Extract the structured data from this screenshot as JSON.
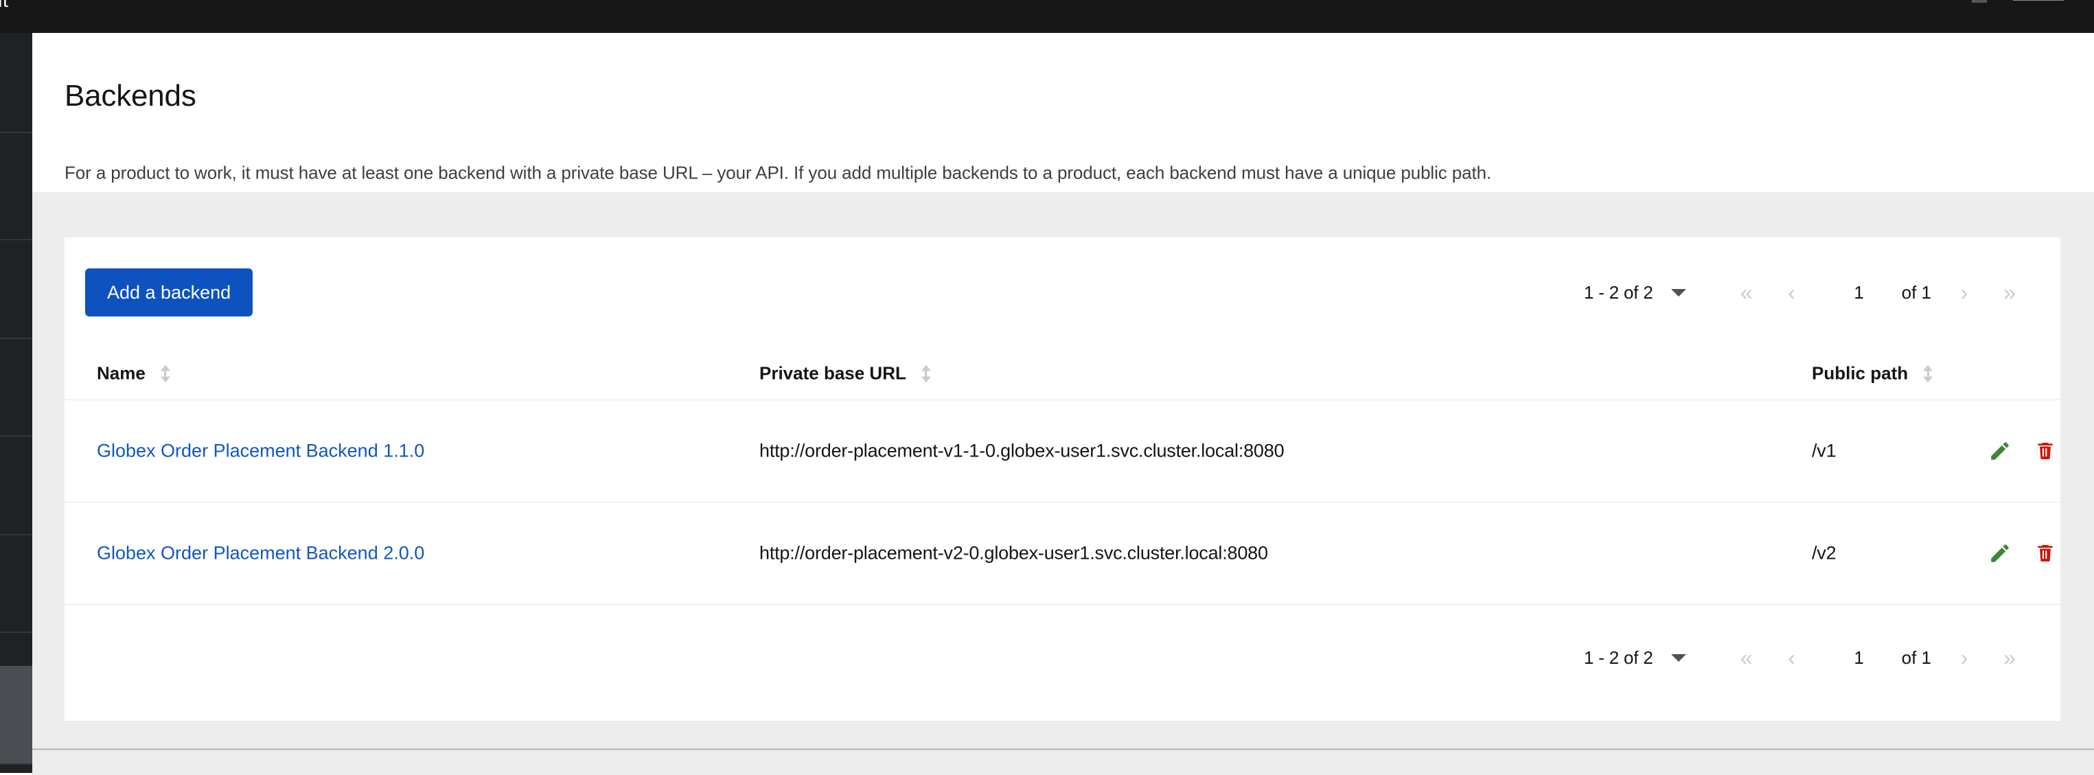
{
  "window": {
    "title_fragment": "ent"
  },
  "page": {
    "title": "Backends",
    "description": "For a product to work, it must have at least one backend with a private base URL – your API. If you add multiple backends to a product, each backend must have a unique public path."
  },
  "toolbar": {
    "add_backend_label": "Add a backend"
  },
  "pagination": {
    "range_label": "1 - 2 of 2",
    "caret_icon": "chevron-down-icon",
    "first_icon": "«",
    "prev_icon": "‹",
    "next_icon": "›",
    "last_icon": "»",
    "current_page": "1",
    "of_label": "of 1"
  },
  "table": {
    "columns": [
      {
        "label": "Name",
        "sort_icon": "sort-icon"
      },
      {
        "label": "Private base URL",
        "sort_icon": "sort-icon"
      },
      {
        "label": "Public path",
        "sort_icon": "sort-icon"
      }
    ],
    "rows": [
      {
        "name": "Globex Order Placement Backend 1.1.0",
        "private_base_url": "http://order-placement-v1-1-0.globex-user1.svc.cluster.local:8080",
        "public_path": "/v1",
        "edit_icon": "pencil-icon",
        "delete_icon": "trash-icon"
      },
      {
        "name": "Globex Order Placement Backend 2.0.0",
        "private_base_url": "http://order-placement-v2-0.globex-user1.svc.cluster.local:8080",
        "public_path": "/v2",
        "edit_icon": "pencil-icon",
        "delete_icon": "trash-icon"
      }
    ]
  },
  "colors": {
    "primary_button": "#0d52bf",
    "link": "#0f56c4",
    "edit_icon": "#3e8635",
    "delete_icon": "#c9190b",
    "titlebar": "#171717",
    "sidebar": "#1f2124",
    "body_background": "#ededed"
  }
}
